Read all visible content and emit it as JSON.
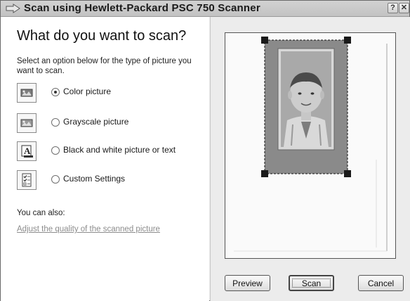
{
  "window": {
    "title": "Scan using Hewlett-Packard PSC 750 Scanner",
    "title_icon": "scanner-arrow-icon",
    "help_label": "?",
    "close_label": "✕"
  },
  "left": {
    "heading": "What do you want to scan?",
    "instructions": "Select an option below for the type of picture you want to scan.",
    "options": [
      {
        "label": "Color picture",
        "icon": "color-picture-icon",
        "selected": true
      },
      {
        "label": "Grayscale picture",
        "icon": "grayscale-picture-icon",
        "selected": false
      },
      {
        "label": "Black and white picture or text",
        "icon": "bw-text-icon",
        "selected": false
      },
      {
        "label": "Custom Settings",
        "icon": "custom-settings-icon",
        "selected": false
      }
    ],
    "also_label": "You can also:",
    "adjust_link": "Adjust the quality of the scanned picture"
  },
  "buttons": {
    "preview": "Preview",
    "scan": "Scan",
    "cancel": "Cancel"
  }
}
